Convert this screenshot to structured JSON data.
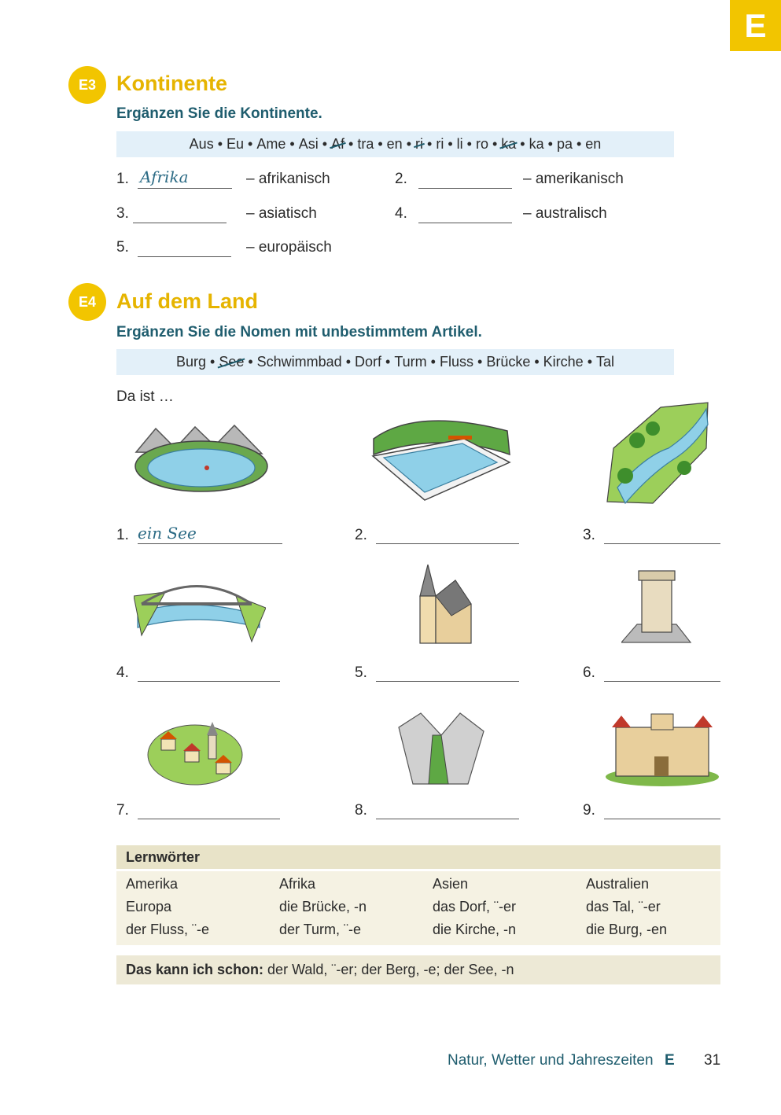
{
  "tab_letter": "E",
  "e3": {
    "badge": "E3",
    "title": "Kontinente",
    "instruction": "Ergänzen Sie die Kontinente.",
    "syllables": [
      {
        "text": "Aus",
        "struck": false
      },
      {
        "text": "Eu",
        "struck": false
      },
      {
        "text": "Ame",
        "struck": false
      },
      {
        "text": "Asi",
        "struck": false
      },
      {
        "text": "Af",
        "struck": true
      },
      {
        "text": "tra",
        "struck": false
      },
      {
        "text": "en",
        "struck": false
      },
      {
        "text": "ri",
        "struck": true
      },
      {
        "text": "ri",
        "struck": false
      },
      {
        "text": "li",
        "struck": false
      },
      {
        "text": "ro",
        "struck": false
      },
      {
        "text": "ka",
        "struck": true
      },
      {
        "text": "ka",
        "struck": false
      },
      {
        "text": "pa",
        "struck": false
      },
      {
        "text": "en",
        "struck": false
      }
    ],
    "items": [
      {
        "num": "1.",
        "answer": "Afrika",
        "adj": "– afrikanisch"
      },
      {
        "num": "2.",
        "answer": "",
        "adj": "– amerikanisch"
      },
      {
        "num": "3.",
        "answer": "",
        "adj": "– asiatisch"
      },
      {
        "num": "4.",
        "answer": "",
        "adj": "– australisch"
      },
      {
        "num": "5.",
        "answer": "",
        "adj": "– europäisch"
      }
    ]
  },
  "e4": {
    "badge": "E4",
    "title": "Auf dem Land",
    "instruction": "Ergänzen Sie die Nomen mit unbestimmtem Artikel.",
    "words": [
      {
        "text": "Burg",
        "struck": false
      },
      {
        "text": "See",
        "struck": true
      },
      {
        "text": "Schwimmbad",
        "struck": false
      },
      {
        "text": "Dorf",
        "struck": false
      },
      {
        "text": "Turm",
        "struck": false
      },
      {
        "text": "Fluss",
        "struck": false
      },
      {
        "text": "Brücke",
        "struck": false
      },
      {
        "text": "Kirche",
        "struck": false
      },
      {
        "text": "Tal",
        "struck": false
      }
    ],
    "intro": "Da ist …",
    "items": [
      {
        "num": "1.",
        "answer": "ein See",
        "icon": "lake-illustration"
      },
      {
        "num": "2.",
        "answer": "",
        "icon": "swimming-pool-illustration"
      },
      {
        "num": "3.",
        "answer": "",
        "icon": "river-illustration"
      },
      {
        "num": "4.",
        "answer": "",
        "icon": "bridge-illustration"
      },
      {
        "num": "5.",
        "answer": "",
        "icon": "church-illustration"
      },
      {
        "num": "6.",
        "answer": "",
        "icon": "tower-illustration"
      },
      {
        "num": "7.",
        "answer": "",
        "icon": "village-illustration"
      },
      {
        "num": "8.",
        "answer": "",
        "icon": "valley-illustration"
      },
      {
        "num": "9.",
        "answer": "",
        "icon": "castle-illustration"
      }
    ]
  },
  "lernwoerter": {
    "title": "Lernwörter",
    "rows": [
      [
        "Amerika",
        "Afrika",
        "Asien",
        "Australien"
      ],
      [
        "Europa",
        "die Brücke, -n",
        "das Dorf, ¨-er",
        "das Tal, ¨-er"
      ],
      [
        "der Fluss, ¨-e",
        "der Turm, ¨-e",
        "die Kirche, -n",
        "die Burg, -en"
      ]
    ]
  },
  "kann": {
    "label": "Das kann ich schon:",
    "text": " der Wald, ¨-er; der Berg, -e; der See, -n"
  },
  "footer": {
    "chapter": "Natur, Wetter und Jahreszeiten",
    "letter": "E",
    "page": "31"
  }
}
